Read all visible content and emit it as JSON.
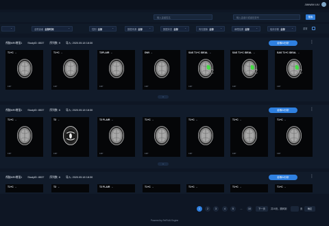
{
  "header": {
    "username": "JIANAN LIU"
  },
  "search": {
    "field1_placeholder": "输入患者姓名",
    "field2_placeholder": "输入患者ID或者检查号",
    "button_label": "搜索"
  },
  "filters": [
    {
      "label": "全院患者",
      "value": "全部时间"
    },
    {
      "label": "性别",
      "value": "全部"
    },
    {
      "label": "数据来源",
      "value": "全部"
    },
    {
      "label": "数据状态",
      "value": "全部"
    },
    {
      "label": "有无图像",
      "value": "全部"
    },
    {
      "label": "病理结果",
      "value": "全部"
    },
    {
      "label": "临床诊断",
      "value": "全部"
    }
  ],
  "reset_label": "重置",
  "studies": [
    {
      "title": "颅脑MRI增强1",
      "study_id": "StudyID: 8537",
      "series": "序列数: 9",
      "imported": "导入: 2020.05.18 18:30",
      "ai_button": "影像AI分析",
      "thumbs": [
        {
          "label": "T1+C",
          "count": "13P"
        },
        {
          "label": "T1+C",
          "count": "13P"
        },
        {
          "label": "T2FLAIR",
          "count": "13P"
        },
        {
          "label": "DWI",
          "count": "13P"
        },
        {
          "label": "SAS T1+C IDEAL",
          "count": "13P"
        },
        {
          "label": "SAS T1+C IDEAL",
          "count": "13P"
        },
        {
          "label": "SAS T1+C IDEAL",
          "count": "13P"
        }
      ]
    },
    {
      "title": "颅脑MRI增强1",
      "study_id": "StudyID: 8537",
      "series": "序列数: 6",
      "imported": "导入: 2020.05.18 18:30",
      "ai_button": "影像AI分析",
      "thumbs": [
        {
          "label": "T1+C",
          "count": "13P"
        },
        {
          "label": "T2",
          "count": "13P"
        },
        {
          "label": "T2 FLAIR",
          "count": "13P"
        },
        {
          "label": "T1+C",
          "count": "13P"
        },
        {
          "label": "T1+C",
          "count": "13P"
        },
        {
          "label": "T1+C",
          "count": "13P"
        },
        {
          "label": "T1+C",
          "count": "13P"
        }
      ]
    },
    {
      "title": "颅脑MRI增强1",
      "study_id": "StudyID: 8537",
      "series": "序列数: 6",
      "imported": "导入: 2020.05.18 18:30",
      "ai_button": "影像AI分析",
      "thumbs": [
        {
          "label": "T1+C"
        },
        {
          "label": "T2"
        },
        {
          "label": "T2 FLAIR"
        },
        {
          "label": "T1+C"
        },
        {
          "label": "T1+C"
        },
        {
          "label": "T1+C"
        },
        {
          "label": "T1+C"
        }
      ]
    }
  ],
  "pagination": {
    "pages": [
      "1",
      "2",
      "3",
      "4",
      "5",
      "...",
      "10"
    ],
    "active": "1",
    "next_label": "下一页",
    "total_text": "共10页，跳转到",
    "unit": "页",
    "confirm": "确定"
  },
  "footer": "Powered by FeiFit AI Engine",
  "colors": {
    "accent": "#2f80e0",
    "lesion": "#39e23a"
  }
}
